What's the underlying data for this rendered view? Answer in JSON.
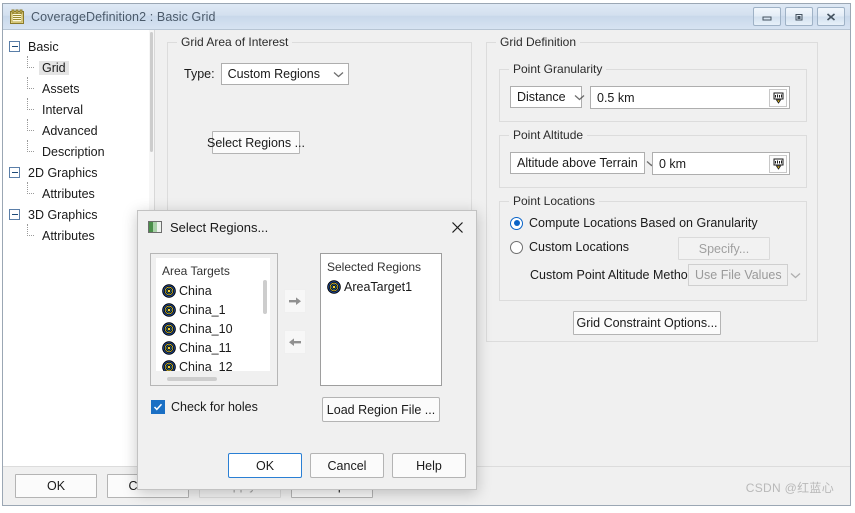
{
  "window": {
    "title": "CoverageDefinition2 : Basic Grid",
    "icon": "clipboard-icon",
    "controls": {
      "minimize": "minimize-icon",
      "maximize": "restore-icon",
      "close": "close-icon"
    }
  },
  "tree": {
    "nodes": [
      {
        "label": "Basic",
        "level": 0,
        "expander": true,
        "selected": false
      },
      {
        "label": "Grid",
        "level": 1,
        "expander": false,
        "selected": true
      },
      {
        "label": "Assets",
        "level": 1,
        "expander": false,
        "selected": false
      },
      {
        "label": "Interval",
        "level": 1,
        "expander": false,
        "selected": false
      },
      {
        "label": "Advanced",
        "level": 1,
        "expander": false,
        "selected": false
      },
      {
        "label": "Description",
        "level": 1,
        "expander": false,
        "selected": false
      },
      {
        "label": "2D Graphics",
        "level": 0,
        "expander": true,
        "selected": false
      },
      {
        "label": "Attributes",
        "level": 1,
        "expander": false,
        "selected": false
      },
      {
        "label": "3D Graphics",
        "level": 0,
        "expander": true,
        "selected": false
      },
      {
        "label": "Attributes",
        "level": 1,
        "expander": false,
        "selected": false
      }
    ]
  },
  "grid_area_of_interest": {
    "title": "Grid Area of Interest",
    "type_label": "Type:",
    "type_value": "Custom Regions",
    "select_regions_button": "Select Regions ..."
  },
  "grid_definition": {
    "title": "Grid Definition",
    "point_granularity": {
      "title": "Point Granularity",
      "mode": "Distance",
      "value": "0.5 km",
      "unit_icon": "unit-picker-icon"
    },
    "point_altitude": {
      "title": "Point Altitude",
      "mode": "Altitude above Terrain",
      "value": "0 km",
      "unit_icon": "unit-picker-icon"
    },
    "point_locations": {
      "title": "Point Locations",
      "option_compute": "Compute Locations Based on Granularity",
      "option_custom": "Custom Locations",
      "selected": "compute",
      "specify_button": "Specify...",
      "custom_altitude_label": "Custom Point Altitude Method:",
      "custom_altitude_value": "Use File Values"
    },
    "grid_constraint_button": "Grid Constraint Options..."
  },
  "footer": {
    "ok": "OK",
    "cancel": "Cancel",
    "apply": "Apply",
    "help": "Help",
    "watermark": "CSDN @红蓝心"
  },
  "dialog": {
    "title": "Select Regions...",
    "icon": "window-icon",
    "close_icon": "close-icon",
    "area_targets": {
      "header": "Area Targets",
      "items": [
        {
          "label": "China",
          "icon": "target-icon"
        },
        {
          "label": "China_1",
          "icon": "target-icon"
        },
        {
          "label": "China_10",
          "icon": "target-icon"
        },
        {
          "label": "China_11",
          "icon": "target-icon"
        },
        {
          "label": "China_12",
          "icon": "target-icon"
        }
      ]
    },
    "selected_regions": {
      "header": "Selected Regions",
      "items": [
        {
          "label": "AreaTarget1",
          "icon": "target-icon"
        }
      ]
    },
    "move_right_icon": "arrow-right-icon",
    "move_left_icon": "arrow-left-icon",
    "check_for_holes": {
      "label": "Check for holes",
      "checked": true
    },
    "load_region_file_button": "Load Region File ...",
    "ok": "OK",
    "cancel": "Cancel",
    "help": "Help"
  }
}
